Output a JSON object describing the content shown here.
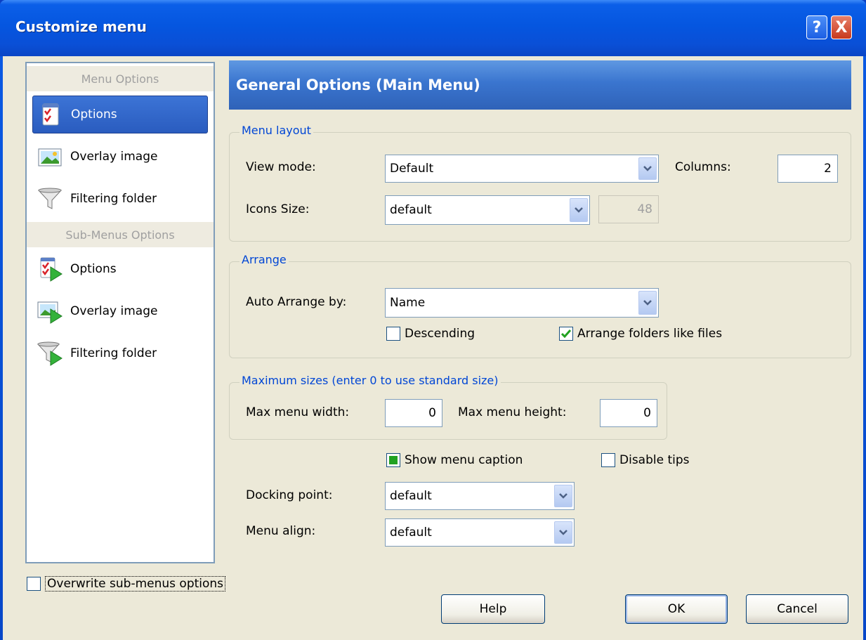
{
  "window": {
    "title": "Customize menu"
  },
  "titlebar_buttons": {
    "help": "?",
    "close": "X"
  },
  "left_panel": {
    "menu_header": "Menu Options",
    "menu_items": [
      {
        "label": "Options",
        "icon": "checklist-icon",
        "selected": true
      },
      {
        "label": "Overlay image",
        "icon": "image-icon",
        "selected": false
      },
      {
        "label": "Filtering folder",
        "icon": "funnel-icon",
        "selected": false
      }
    ],
    "submenu_header": "Sub-Menus Options",
    "submenu_items": [
      {
        "label": "Options",
        "icon": "checklist-arrow-icon"
      },
      {
        "label": "Overlay image",
        "icon": "image-arrow-icon"
      },
      {
        "label": "Filtering folder",
        "icon": "funnel-arrow-icon"
      }
    ]
  },
  "header": {
    "title": "General Options (Main Menu)"
  },
  "menu_layout": {
    "legend": "Menu layout",
    "view_mode_label": "View mode:",
    "view_mode_value": "Default",
    "columns_label": "Columns:",
    "columns_value": "2",
    "icons_size_label": "Icons Size:",
    "icons_size_value": "default",
    "icons_size_number": "48"
  },
  "arrange": {
    "legend": "Arrange",
    "auto_arrange_label": "Auto Arrange by:",
    "auto_arrange_value": "Name",
    "descending_label": "Descending",
    "descending_checked": false,
    "folders_like_files_label": "Arrange folders like files",
    "folders_like_files_checked": true
  },
  "max_sizes": {
    "legend": "Maximum sizes (enter 0 to use standard size)",
    "width_label": "Max menu width:",
    "width_value": "0",
    "height_label": "Max menu height:",
    "height_value": "0"
  },
  "options": {
    "show_caption_label": "Show menu caption",
    "show_caption_state": "indeterminate",
    "disable_tips_label": "Disable tips",
    "disable_tips_checked": false,
    "docking_label": "Docking point:",
    "docking_value": "default",
    "align_label": "Menu align:",
    "align_value": "default"
  },
  "footer": {
    "overwrite_label": "Overwrite sub-menus options",
    "overwrite_checked": false,
    "help_button": "Help",
    "ok_button": "OK",
    "cancel_button": "Cancel"
  },
  "colors": {
    "titlebar": "#0556e0",
    "header_blue": "#3a75cf",
    "legend_blue": "#0046d5",
    "dialog_bg": "#ece9d8"
  }
}
